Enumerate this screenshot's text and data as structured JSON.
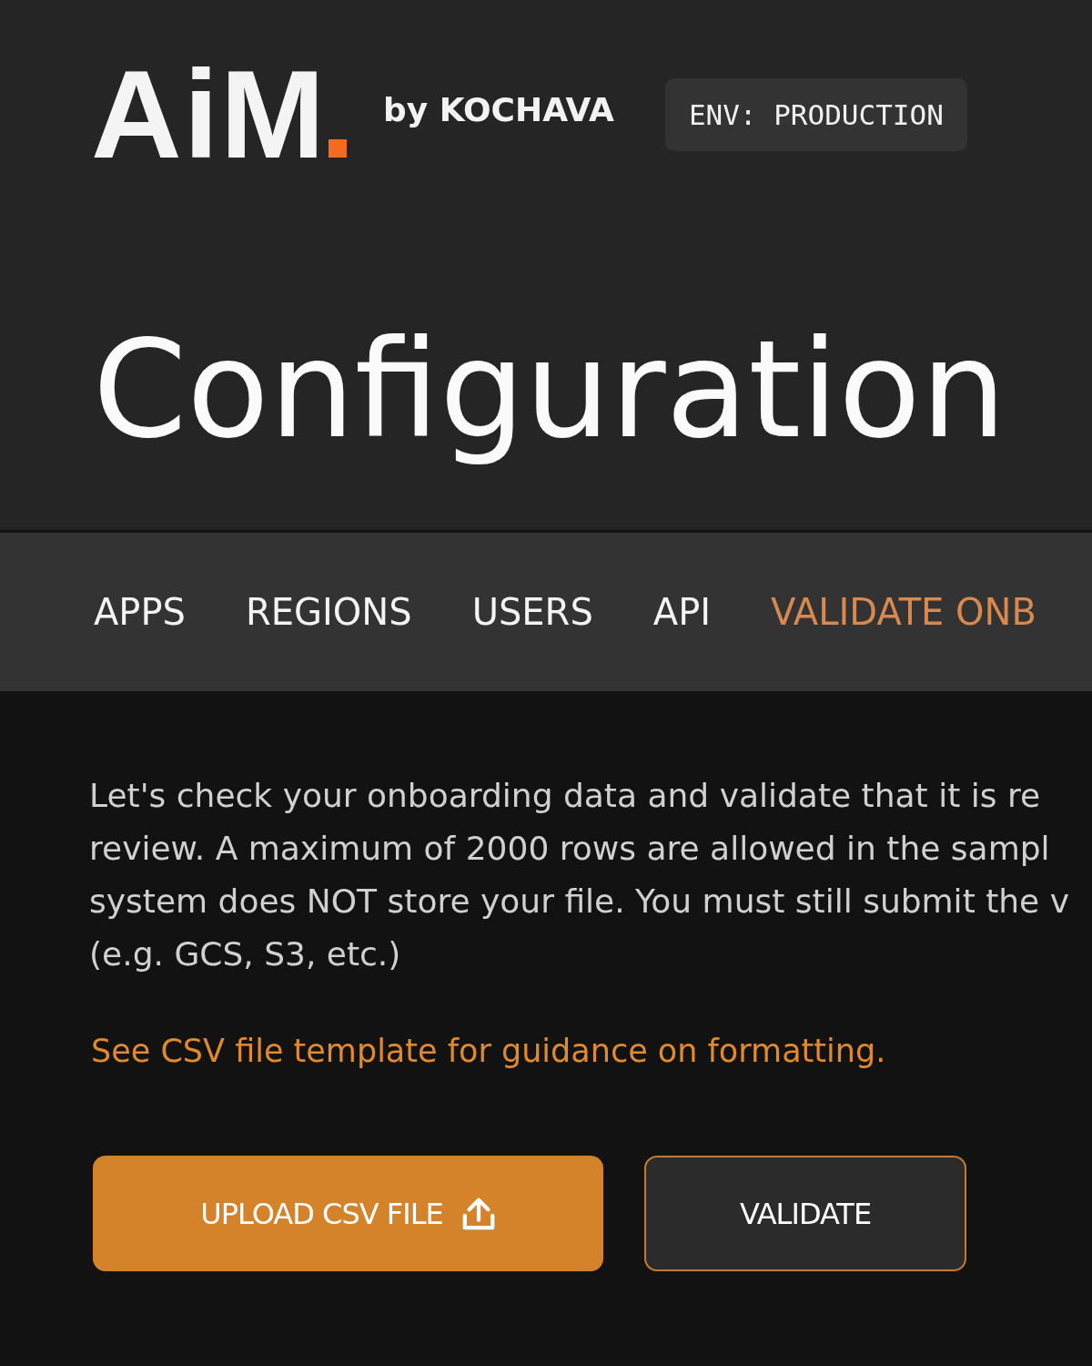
{
  "header": {
    "logo": {
      "text": "AiM"
    },
    "byline": "by KOCHAVA",
    "env_badge": "ENV: PRODUCTION"
  },
  "page_title": "Configuration",
  "tabs": [
    {
      "label": "APPS",
      "selected": false
    },
    {
      "label": "REGIONS",
      "selected": false
    },
    {
      "label": "USERS",
      "selected": false
    },
    {
      "label": "API",
      "selected": false
    },
    {
      "label": "VALIDATE ONB",
      "selected": true
    }
  ],
  "content": {
    "intro_lines": [
      "Let's check your onboarding data and validate that it is re",
      "review. A maximum of 2000 rows are allowed in the sampl",
      "system does NOT store your file. You must still submit the v",
      "(e.g. GCS, S3, etc.)"
    ],
    "template_link": "See CSV file template for guidance on formatting.",
    "buttons": [
      {
        "kind": "primary",
        "label": "UPLOAD CSV FILE"
      },
      {
        "kind": "outline",
        "label": "VALIDATE"
      }
    ]
  }
}
